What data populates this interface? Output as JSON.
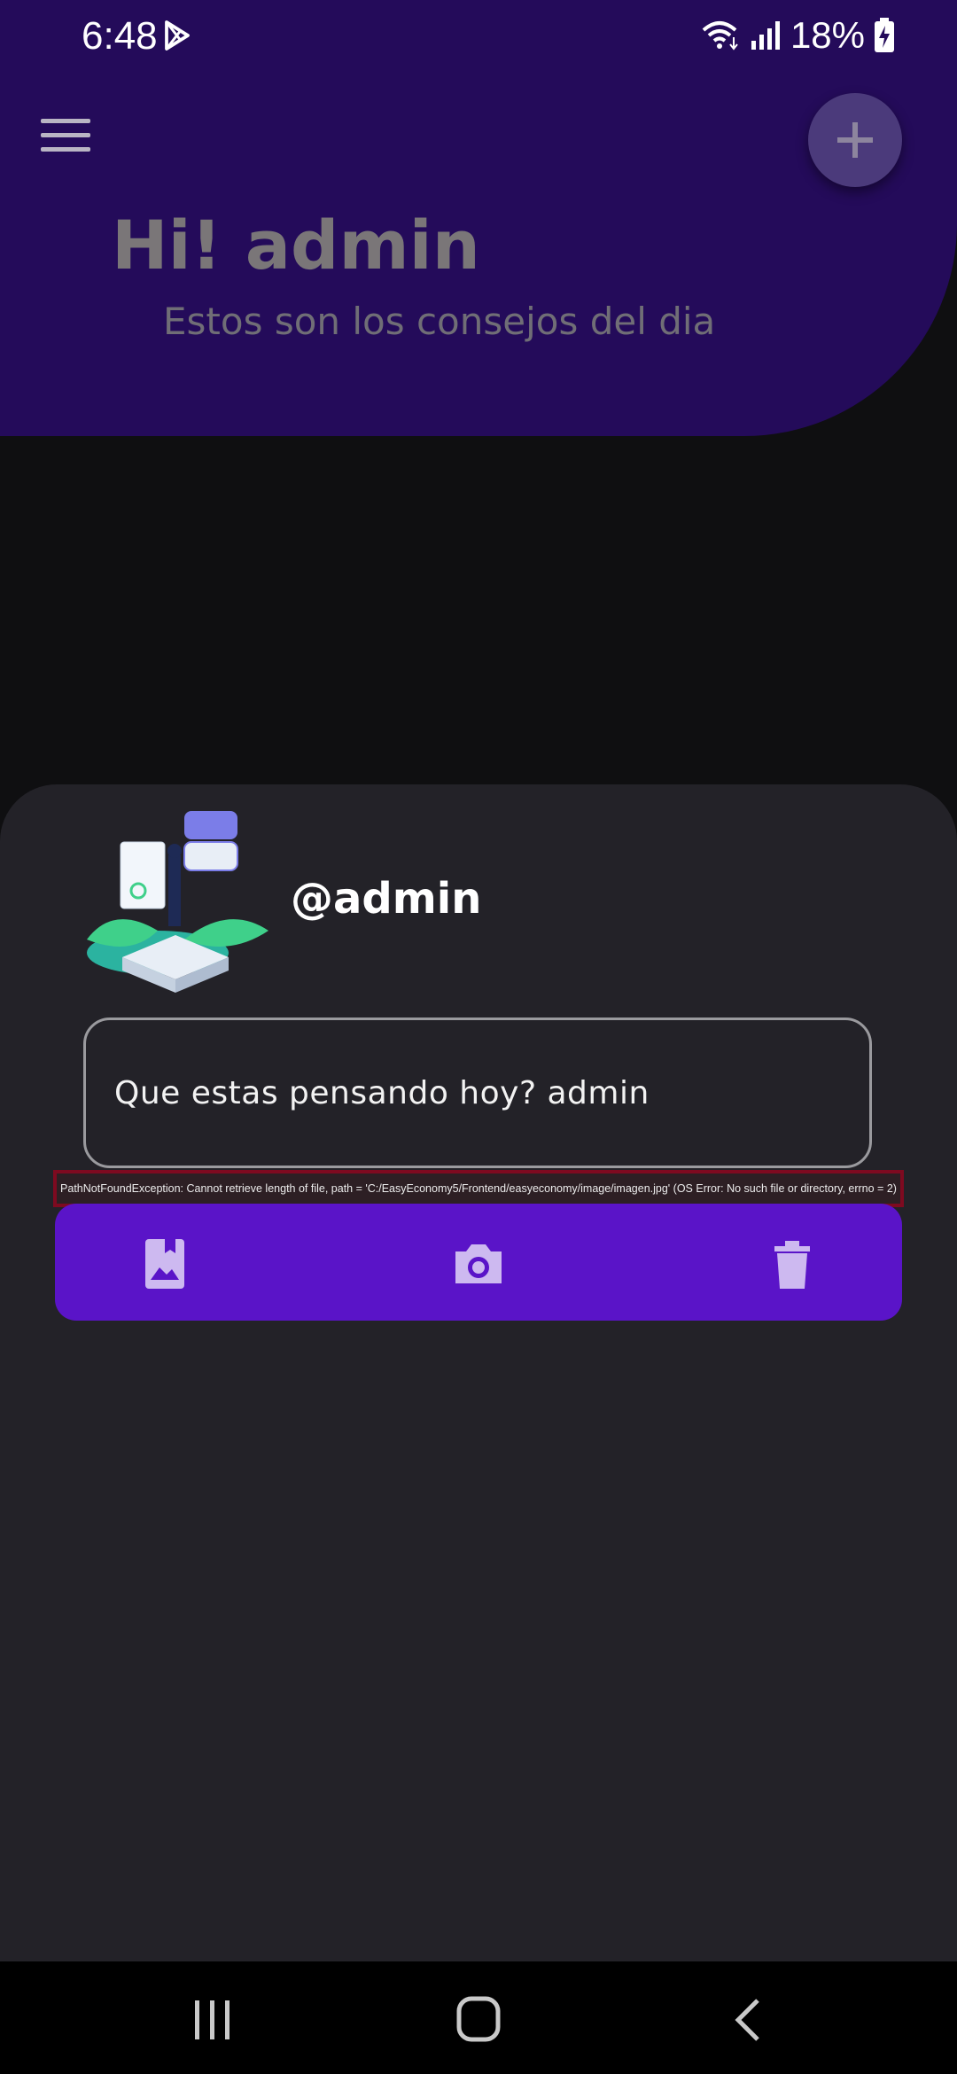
{
  "status_bar": {
    "time": "6:48",
    "battery": "18%"
  },
  "header": {
    "greeting": "Hi! admin",
    "subtitle": "Estos son los consejos del dia"
  },
  "profile": {
    "handle": "@admin"
  },
  "post": {
    "placeholder": "Que estas pensando hoy? admin"
  },
  "error": {
    "message": "PathNotFoundException: Cannot retrieve length of file, path = 'C:/EasyEconomy5/Frontend/easyeconomy/image/imagen.jpg' (OS Error: No such file or directory, errno = 2)"
  },
  "toolbar": {
    "items": [
      "image-icon",
      "camera-icon",
      "trash-icon"
    ]
  },
  "colors": {
    "header_bg": "#240b5a",
    "sheet_bg": "#232228",
    "toolbar_bg": "#5a14c8",
    "error_border": "#7e0a20"
  }
}
